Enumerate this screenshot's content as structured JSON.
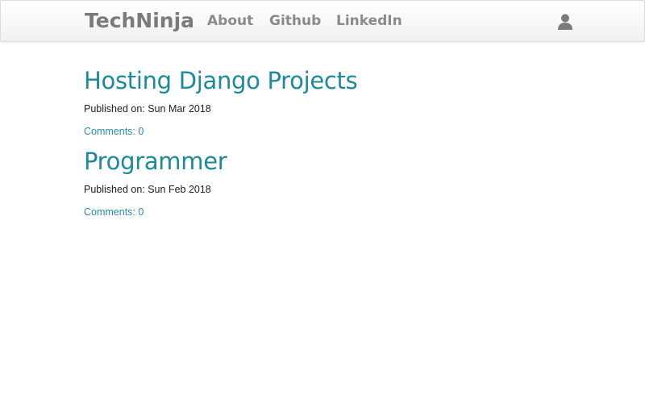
{
  "navbar": {
    "brand": "TechNinja",
    "links": [
      {
        "label": "About"
      },
      {
        "label": "Github"
      },
      {
        "label": "LinkedIn"
      }
    ],
    "user_icon": "user-icon"
  },
  "posts": [
    {
      "title": "Hosting Django Projects",
      "published": "Published on: Sun Mar 2018",
      "comments": "Comments: 0"
    },
    {
      "title": "Programmer",
      "published": "Published on: Sun Feb 2018",
      "comments": "Comments: 0"
    }
  ],
  "colors": {
    "link_title": "#1c8a9a",
    "link_comments": "#2a8ab5",
    "nav_text": "#8a8a8a"
  }
}
